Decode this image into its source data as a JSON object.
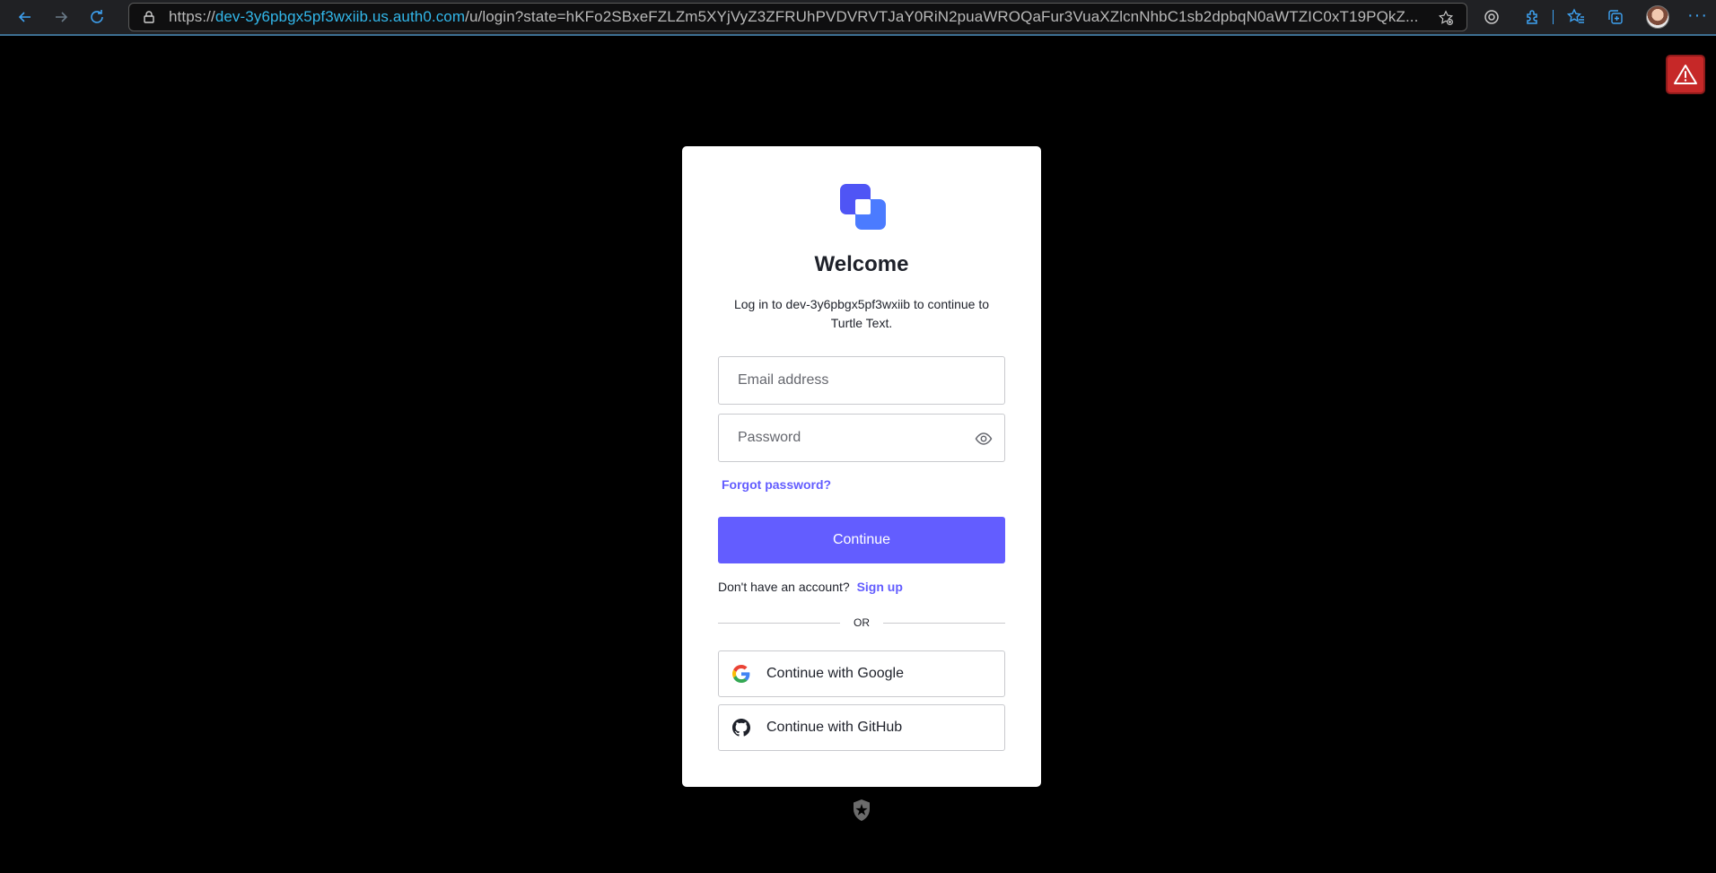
{
  "browser": {
    "url_scheme": "https://",
    "url_host": "dev-3y6pbgx5pf3wxiib.us.auth0.com",
    "url_path": "/u/login?state=hKFo2SBxeFZLZm5XYjVyZ3ZFRUhPVDVRVTJaY0RiN2puaWROQaFur3VuaXZlcnNhbC1sb2dpbqN0aWTZIC0xT19PQkZ..."
  },
  "login": {
    "title": "Welcome",
    "description": "Log in to dev-3y6pbgx5pf3wxiib to continue to Turtle Text.",
    "email_placeholder": "Email address",
    "password_placeholder": "Password",
    "forgot_password": "Forgot password?",
    "continue_label": "Continue",
    "no_account_text": "Don't have an account?",
    "signup_label": "Sign up",
    "divider_text": "OR",
    "google_label": "Continue with Google",
    "github_label": "Continue with GitHub"
  },
  "colors": {
    "accent": "#635dff",
    "page_background": "#000000",
    "warning_badge": "#c62828"
  },
  "icons": {
    "back": "arrow-left-icon",
    "forward": "arrow-right-icon",
    "refresh": "refresh-icon",
    "lock": "lock-icon",
    "favorite_add": "star-add-icon",
    "tracking": "tracking-prevention-icon",
    "extensions": "puzzle-icon",
    "favorites": "favorites-icon",
    "collections": "collections-icon",
    "warning": "warning-icon",
    "eye": "eye-icon",
    "google": "google-icon",
    "github": "github-icon",
    "auth0": "auth0-logo-icon"
  }
}
